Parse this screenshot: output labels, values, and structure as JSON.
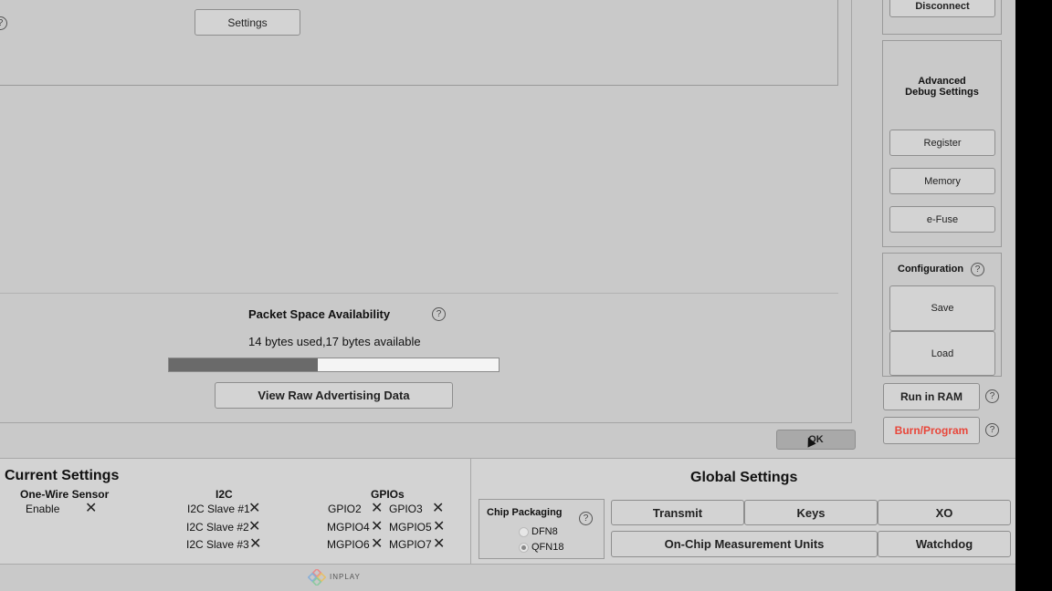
{
  "top": {
    "settings_label": "Settings",
    "help_glyph": "?"
  },
  "right_panel": {
    "disconnect_label": "Disconnect",
    "advanced_title": "Advanced\nDebug Settings",
    "register_label": "Register",
    "memory_label": "Memory",
    "efuse_label": "e-Fuse",
    "config_title": "Configuration",
    "save_label": "Save",
    "load_label": "Load",
    "run_in_ram_label": "Run in RAM",
    "burn_label": "Burn/Program",
    "burn_color": "#e8463a"
  },
  "packet": {
    "title": "Packet Space Availability",
    "usage_text": "14 bytes used,17 bytes available",
    "used_fraction": 0.4516,
    "view_raw_label": "View Raw Advertising Data",
    "ok_label": "OK"
  },
  "current_settings": {
    "title": "Current Settings",
    "one_wire": {
      "header": "One-Wire Sensor",
      "items": [
        "Enable"
      ]
    },
    "i2c": {
      "header": "I2C",
      "items": [
        "I2C Slave #1",
        "I2C Slave #2",
        "I2C Slave #3"
      ]
    },
    "gpios": {
      "header": "GPIOs",
      "items": [
        "GPIO2",
        "GPIO3",
        "MGPIO4",
        "MGPIO5",
        "MGPIO6",
        "MGPIO7"
      ]
    },
    "x_glyph": "✕"
  },
  "global_settings": {
    "title": "Global Settings",
    "chip_packaging": {
      "label": "Chip Packaging",
      "options": [
        "DFN8",
        "QFN18"
      ],
      "selected": "QFN18"
    },
    "transmit_label": "Transmit",
    "keys_label": "Keys",
    "xo_label": "XO",
    "measurement_label": "On-Chip Measurement Units",
    "watchdog_label": "Watchdog"
  },
  "footer": {
    "brand": "INPLAY"
  }
}
